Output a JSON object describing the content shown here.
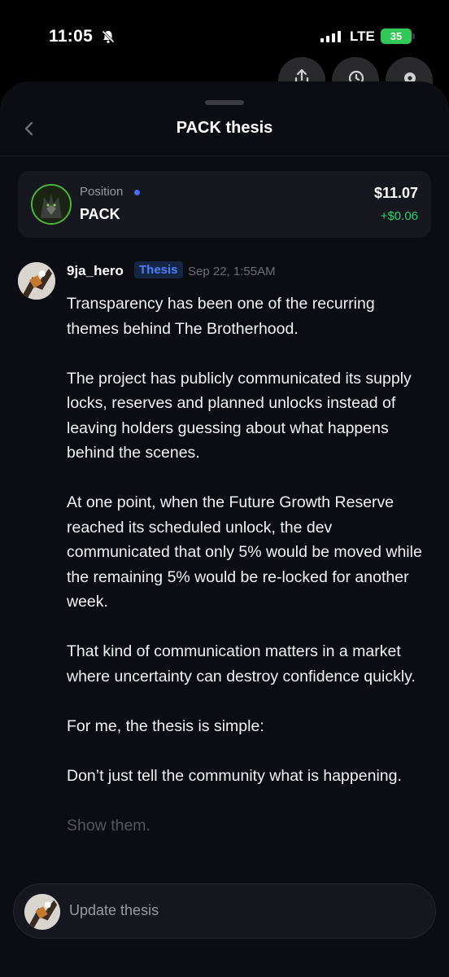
{
  "status": {
    "time": "11:05",
    "network": "LTE",
    "battery": "35"
  },
  "header": {
    "title": "PACK thesis"
  },
  "position": {
    "label": "Position",
    "ticker": "PACK",
    "value": "$11.07",
    "change": "+$0.06"
  },
  "post": {
    "author": "9ja_hero",
    "badge": "Thesis",
    "date": "Sep 22, 1:55AM",
    "paragraphs": [
      "Transparency has been one of the recurring themes behind The Brotherhood.",
      "The project has publicly communicated its supply locks, reserves and planned unlocks instead of leaving holders guessing about what happens behind the scenes.",
      "At one point, when the Future Growth Reserve reached its scheduled unlock, the dev communicated that only 5% would be moved while the remaining 5% would be re-locked for another week.",
      "That kind of communication matters in a market where uncertainty can destroy confidence quickly.",
      "For me, the thesis is simple:",
      "Don’t just tell the community what is happening.",
      "Show them."
    ]
  },
  "composer": {
    "placeholder": "Update thesis"
  },
  "colors": {
    "accent_blue": "#4f7df3",
    "positive_green": "#2fd074",
    "battery_green": "#30c957"
  }
}
